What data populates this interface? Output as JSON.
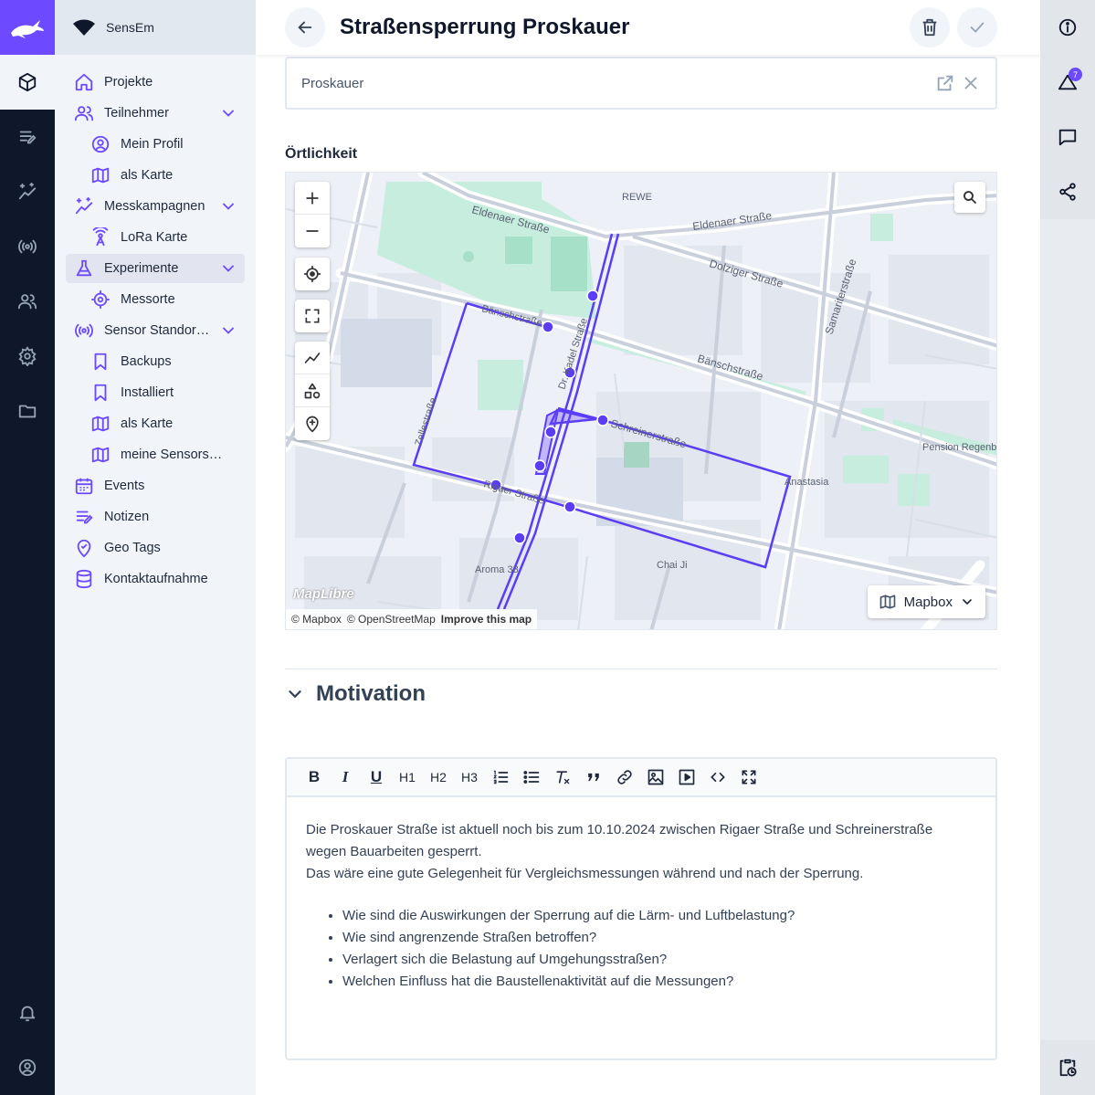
{
  "app": {
    "name": "SensEm"
  },
  "colors": {
    "accent": "#6d4aff",
    "rail_bg": "#0f172a",
    "route": "#6d4aff"
  },
  "rail": {
    "items": [
      {
        "icon": "cube-icon",
        "active": true
      },
      {
        "icon": "notes-icon"
      },
      {
        "icon": "sparkle-chart-icon"
      },
      {
        "icon": "broadcast-icon"
      },
      {
        "icon": "users-icon"
      },
      {
        "icon": "gear-icon"
      },
      {
        "icon": "folder-icon"
      }
    ],
    "bottom": [
      "bell-icon",
      "account-circle-icon"
    ]
  },
  "sidebar": {
    "items": [
      {
        "label": "Projekte",
        "icon": "home-icon"
      },
      {
        "label": "Teilnehmer",
        "icon": "users-icon",
        "expandable": true
      },
      {
        "label": "Mein Profil",
        "icon": "user-circle-icon",
        "sub": true
      },
      {
        "label": "als Karte",
        "icon": "map-icon",
        "sub": true
      },
      {
        "label": "Messkampagnen",
        "icon": "sparkles-icon",
        "expandable": true
      },
      {
        "label": "LoRa Karte",
        "icon": "antenna-icon",
        "sub": true
      },
      {
        "label": "Experimente",
        "icon": "flask-icon",
        "expandable": true,
        "active": true
      },
      {
        "label": "Messorte",
        "icon": "target-icon",
        "sub": true
      },
      {
        "label": "Sensor Standor…",
        "icon": "broadcast-icon",
        "expandable": true
      },
      {
        "label": "Backups",
        "icon": "bookmark-icon",
        "sub": true
      },
      {
        "label": "Installiert",
        "icon": "bookmark-icon",
        "sub": true
      },
      {
        "label": "als Karte",
        "icon": "map-icon",
        "sub": true
      },
      {
        "label": "meine Sensors…",
        "icon": "map-icon",
        "sub": true
      },
      {
        "label": "Events",
        "icon": "calendar-icon"
      },
      {
        "label": "Notizen",
        "icon": "notes-icon"
      },
      {
        "label": "Geo Tags",
        "icon": "geotag-icon"
      },
      {
        "label": "Kontaktaufnahme",
        "icon": "database-icon"
      }
    ]
  },
  "header": {
    "title": "Straßensperrung Proskauer"
  },
  "location": {
    "value": "Proskauer"
  },
  "map_section": {
    "label": "Örtlichkeit",
    "style_button": "Mapbox",
    "attribution": {
      "mapbox": "© Mapbox",
      "osm": "© OpenStreetMap",
      "improve": "Improve this map"
    },
    "logo": "MapLibre",
    "street_labels": [
      "Eldenaer Straße",
      "Eldenaer Straße",
      "Dolziger Straße",
      "Bänschstraße",
      "Bänschstraße",
      "Samariterstraße",
      "Schreinerstraße",
      "Zellestraße",
      "Rigaer Straße",
      "Pension Regenb",
      "Anastasia",
      "Chai Ji",
      "Aroma 33",
      "REWE",
      "Dr. Kadel Straße"
    ]
  },
  "motivation": {
    "title": "Motivation",
    "toolbar": [
      "B",
      "I",
      "U",
      "H1",
      "H2",
      "H3",
      "ordered-list-icon",
      "bullet-list-icon",
      "clear-format-icon",
      "quote-icon",
      "link-icon",
      "image-icon",
      "video-icon",
      "code-icon",
      "fullscreen-icon"
    ],
    "paragraph1": "Die Proskauer Straße ist aktuell noch bis zum 10.10.2024 zwischen Rigaer Straße und Schreinerstraße wegen Bauarbeiten gesperrt.",
    "paragraph2": "Das wäre eine gute Gelegenheit für Vergleichsmessungen während und nach der Sperrung.",
    "bullets": [
      "Wie sind die Auswirkungen der Sperrung auf die Lärm- und Luftbelastung?",
      "Wie sind angrenzende Straßen betroffen?",
      "Verlagert sich die Belastung auf Umgehungsstraßen?",
      "Welchen Einfluss hat die Baustellenaktivität auf die Messungen?"
    ]
  },
  "right_rail": {
    "badge": "7"
  }
}
